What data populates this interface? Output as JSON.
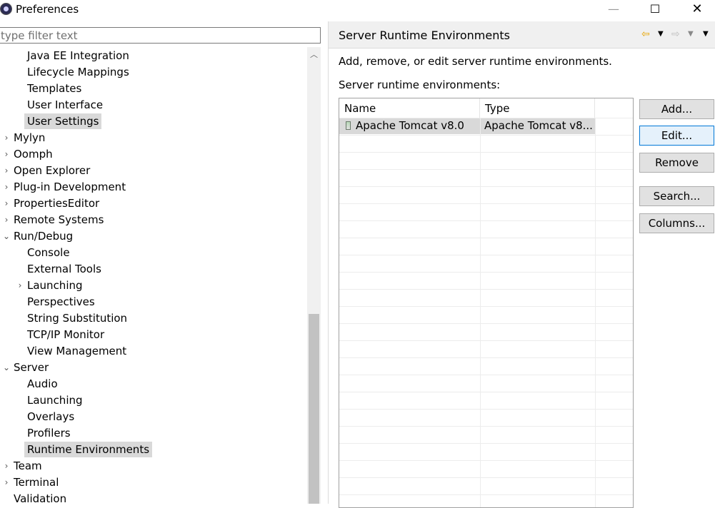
{
  "window": {
    "title": "Preferences",
    "minimize": "—",
    "maximize": "☐",
    "close": "✕"
  },
  "filter": {
    "placeholder": "type filter text"
  },
  "tree": [
    {
      "label": "Java EE Integration",
      "indent": 1,
      "twisty": ""
    },
    {
      "label": "Lifecycle Mappings",
      "indent": 1,
      "twisty": ""
    },
    {
      "label": "Templates",
      "indent": 1,
      "twisty": ""
    },
    {
      "label": "User Interface",
      "indent": 1,
      "twisty": ""
    },
    {
      "label": "User Settings",
      "indent": 1,
      "twisty": "",
      "selected": true
    },
    {
      "label": "Mylyn",
      "indent": 0,
      "twisty": "›"
    },
    {
      "label": "Oomph",
      "indent": 0,
      "twisty": "›"
    },
    {
      "label": "Open Explorer",
      "indent": 0,
      "twisty": "›"
    },
    {
      "label": "Plug-in Development",
      "indent": 0,
      "twisty": "›"
    },
    {
      "label": "PropertiesEditor",
      "indent": 0,
      "twisty": "›"
    },
    {
      "label": "Remote Systems",
      "indent": 0,
      "twisty": "›"
    },
    {
      "label": "Run/Debug",
      "indent": 0,
      "twisty": "⌄"
    },
    {
      "label": "Console",
      "indent": 1,
      "twisty": ""
    },
    {
      "label": "External Tools",
      "indent": 1,
      "twisty": ""
    },
    {
      "label": "Launching",
      "indent": 1,
      "twisty": "›"
    },
    {
      "label": "Perspectives",
      "indent": 1,
      "twisty": ""
    },
    {
      "label": "String Substitution",
      "indent": 1,
      "twisty": ""
    },
    {
      "label": "TCP/IP Monitor",
      "indent": 1,
      "twisty": ""
    },
    {
      "label": "View Management",
      "indent": 1,
      "twisty": ""
    },
    {
      "label": "Server",
      "indent": 0,
      "twisty": "⌄"
    },
    {
      "label": "Audio",
      "indent": 1,
      "twisty": ""
    },
    {
      "label": "Launching",
      "indent": 1,
      "twisty": ""
    },
    {
      "label": "Overlays",
      "indent": 1,
      "twisty": ""
    },
    {
      "label": "Profilers",
      "indent": 1,
      "twisty": ""
    },
    {
      "label": "Runtime Environments",
      "indent": 1,
      "twisty": "",
      "selected": true
    },
    {
      "label": "Team",
      "indent": 0,
      "twisty": "›"
    },
    {
      "label": "Terminal",
      "indent": 0,
      "twisty": "›"
    },
    {
      "label": "Validation",
      "indent": 0,
      "twisty": ""
    }
  ],
  "page": {
    "title": "Server Runtime Environments",
    "description": "Add, remove, or edit server runtime environments.",
    "list_label": "Server runtime environments:",
    "nav": {
      "back": "⇦",
      "back_menu": "▼",
      "forward": "⇨",
      "forward_menu": "▼",
      "view_menu": "▼"
    }
  },
  "table": {
    "columns": [
      "Name",
      "Type"
    ],
    "rows": [
      {
        "name": "Apache Tomcat v8.0",
        "type": "Apache Tomcat v8...",
        "selected": true
      }
    ]
  },
  "buttons": {
    "add": "Add...",
    "edit": "Edit...",
    "remove": "Remove",
    "search": "Search...",
    "columns": "Columns..."
  },
  "colors": {
    "selection": "#d9d9d9",
    "focus_border": "#0078d7",
    "back_arrow": "#e8a400"
  }
}
